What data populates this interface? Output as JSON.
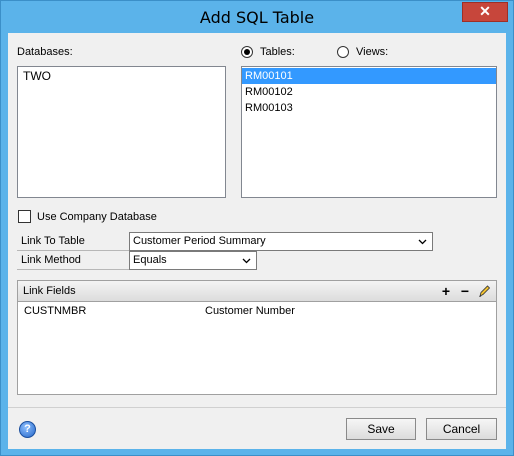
{
  "window": {
    "title": "Add SQL Table",
    "close_label": "✕"
  },
  "databases": {
    "label": "Databases:",
    "items": [
      "TWO"
    ]
  },
  "source": {
    "tables_label": "Tables:",
    "views_label": "Views:",
    "selected": "tables",
    "items": [
      {
        "name": "RM00101",
        "selected": true
      },
      {
        "name": "RM00102",
        "selected": false
      },
      {
        "name": "RM00103",
        "selected": false
      }
    ]
  },
  "use_company_database": {
    "label": "Use Company Database",
    "checked": false
  },
  "link_to_table": {
    "label": "Link To Table",
    "value": "Customer Period Summary"
  },
  "link_method": {
    "label": "Link Method",
    "value": "Equals"
  },
  "link_fields": {
    "title": "Link Fields",
    "rows": [
      {
        "field": "CUSTNMBR",
        "description": "Customer Number"
      }
    ]
  },
  "footer": {
    "help_label": "?",
    "save_label": "Save",
    "cancel_label": "Cancel"
  },
  "colors": {
    "titlebar": "#5bb3ea",
    "selection": "#3399ff",
    "close": "#c7463b"
  }
}
